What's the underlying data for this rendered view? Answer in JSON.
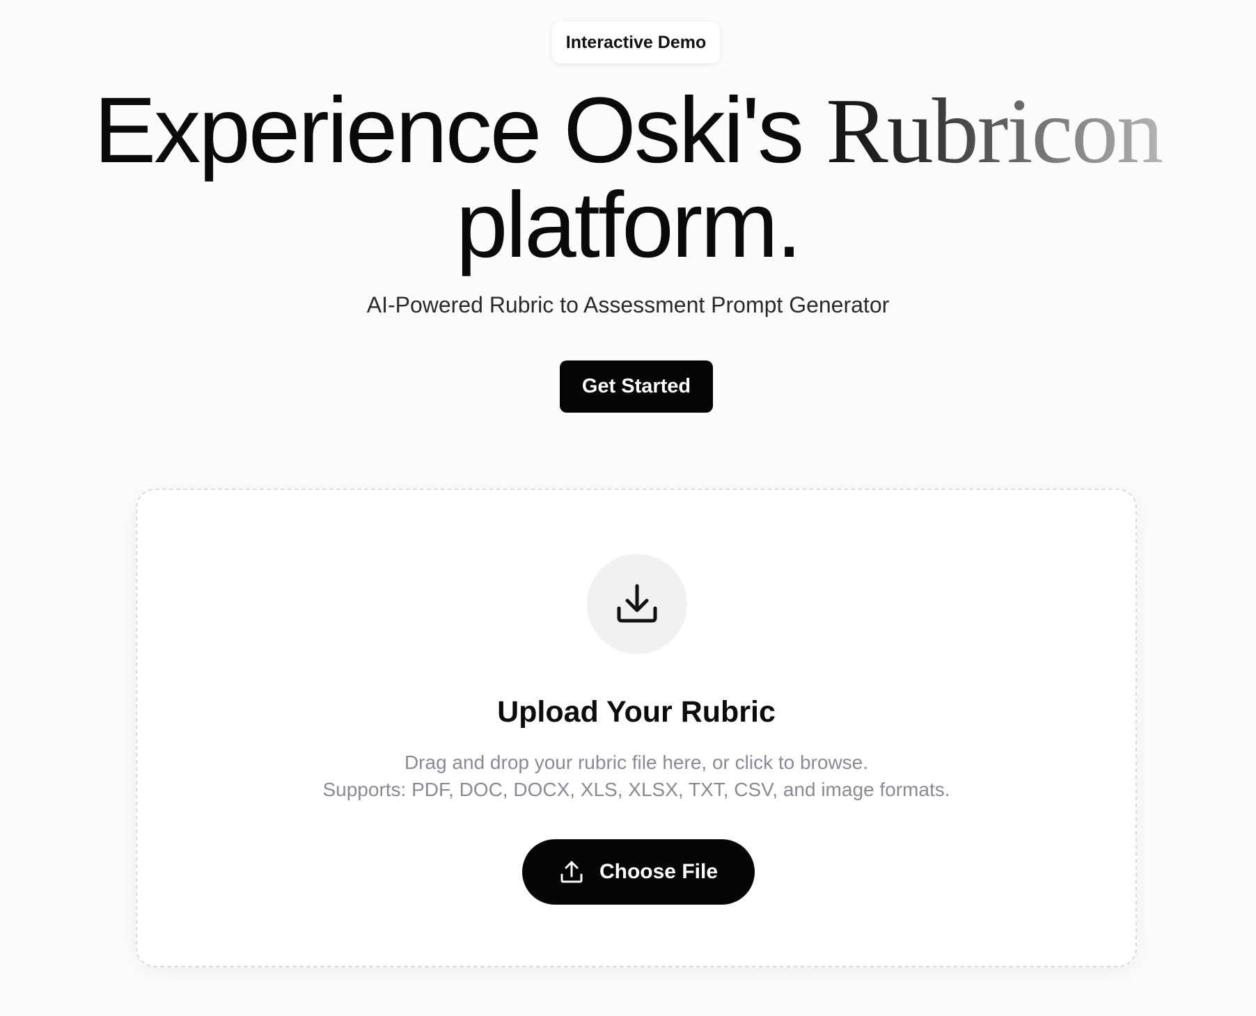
{
  "badge": {
    "label": "Interactive Demo"
  },
  "hero": {
    "title_part1": "Experience Oski's",
    "title_brand": "Rubricon",
    "title_part2": "platform."
  },
  "subtitle": "AI-Powered Rubric to Assessment Prompt Generator",
  "cta": {
    "label": "Get Started"
  },
  "upload": {
    "icon": "download-tray-icon",
    "title": "Upload Your Rubric",
    "description_line1": "Drag and drop your rubric file here, or click to browse.",
    "description_line2": "Supports: PDF, DOC, DOCX, XLS, XLSX, TXT, CSV, and image formats.",
    "button_label": "Choose File",
    "button_icon": "upload-icon"
  },
  "colors": {
    "background": "#fbfcfb",
    "primary_button": "#050505",
    "muted_text": "#8a8a92",
    "icon_circle": "#f1f1f2"
  }
}
